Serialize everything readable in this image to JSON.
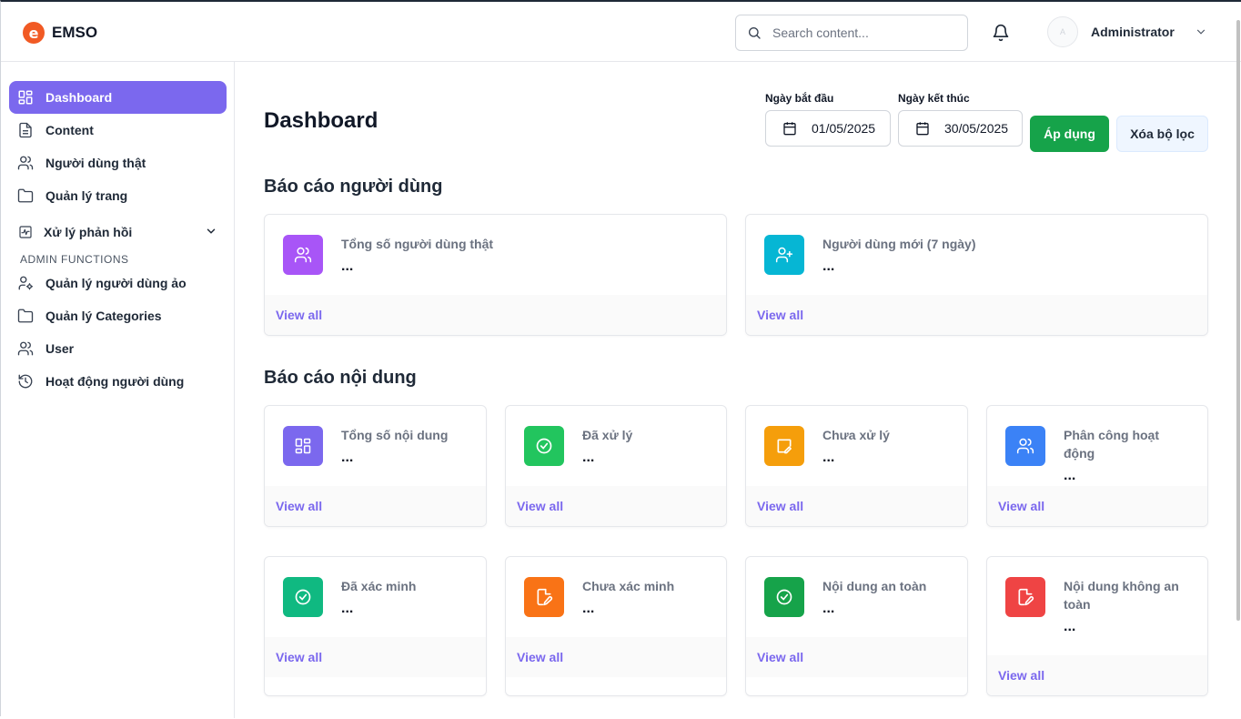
{
  "header": {
    "logo_text": "EMSO",
    "search_placeholder": "Search content...",
    "user_name": "Administrator",
    "avatar_text": "A"
  },
  "sidebar": {
    "items": [
      {
        "label": "Dashboard",
        "icon": "dashboard-grid-icon",
        "active": true
      },
      {
        "label": "Content",
        "icon": "document-icon"
      },
      {
        "label": "Người dùng thật",
        "icon": "users-icon"
      },
      {
        "label": "Quản lý trang",
        "icon": "folder-icon"
      },
      {
        "label": "Xử lý phản hồi",
        "icon": "activity-icon",
        "expandable": true
      }
    ],
    "admin_section_label": "ADMIN FUNCTIONS",
    "admin_items": [
      {
        "label": "Quản lý người dùng ảo",
        "icon": "user-settings-icon"
      },
      {
        "label": "Quản lý Categories",
        "icon": "folder-icon"
      },
      {
        "label": "User",
        "icon": "users-icon"
      },
      {
        "label": "Hoạt động người dùng",
        "icon": "history-icon"
      }
    ]
  },
  "main": {
    "title": "Dashboard",
    "filters": {
      "start_label": "Ngày bắt đầu",
      "start_value": "01/05/2025",
      "end_label": "Ngày kết thúc",
      "end_value": "30/05/2025",
      "apply_label": "Áp dụng",
      "clear_label": "Xóa bộ lọc"
    },
    "user_report": {
      "title": "Báo cáo người dùng",
      "cards": [
        {
          "label": "Tổng số người dùng thật",
          "value": "...",
          "link": "View all",
          "color": "#a855f7",
          "icon": "users-icon"
        },
        {
          "label": "Người dùng mới (7 ngày)",
          "value": "...",
          "link": "View all",
          "color": "#06b6d4",
          "icon": "user-plus-icon"
        }
      ]
    },
    "content_report": {
      "title": "Báo cáo nội dung",
      "cards": [
        {
          "label": "Tổng số nội dung",
          "value": "...",
          "link": "View all",
          "color": "#7b68ee",
          "icon": "grid-icon"
        },
        {
          "label": "Đã xử lý",
          "value": "...",
          "link": "View all",
          "color": "#22c55e",
          "icon": "check-circle-icon"
        },
        {
          "label": "Chưa xử lý",
          "value": "...",
          "link": "View all",
          "color": "#f59e0b",
          "icon": "edit-icon"
        },
        {
          "label": "Phân công hoạt động",
          "value": "...",
          "link": "View all",
          "color": "#3b82f6",
          "icon": "users-icon"
        },
        {
          "label": "Đã xác minh",
          "value": "...",
          "link": "View all",
          "color": "#10b981",
          "icon": "check-circle-icon"
        },
        {
          "label": "Chưa xác minh",
          "value": "...",
          "link": "View all",
          "color": "#f97316",
          "icon": "file-edit-icon"
        },
        {
          "label": "Nội dung an toàn",
          "value": "...",
          "link": "View all",
          "color": "#16a34a",
          "icon": "check-circle-icon"
        },
        {
          "label": "Nội dung không an toàn",
          "value": "...",
          "link": "View all",
          "color": "#ef4444",
          "icon": "file-edit-icon"
        }
      ]
    }
  }
}
